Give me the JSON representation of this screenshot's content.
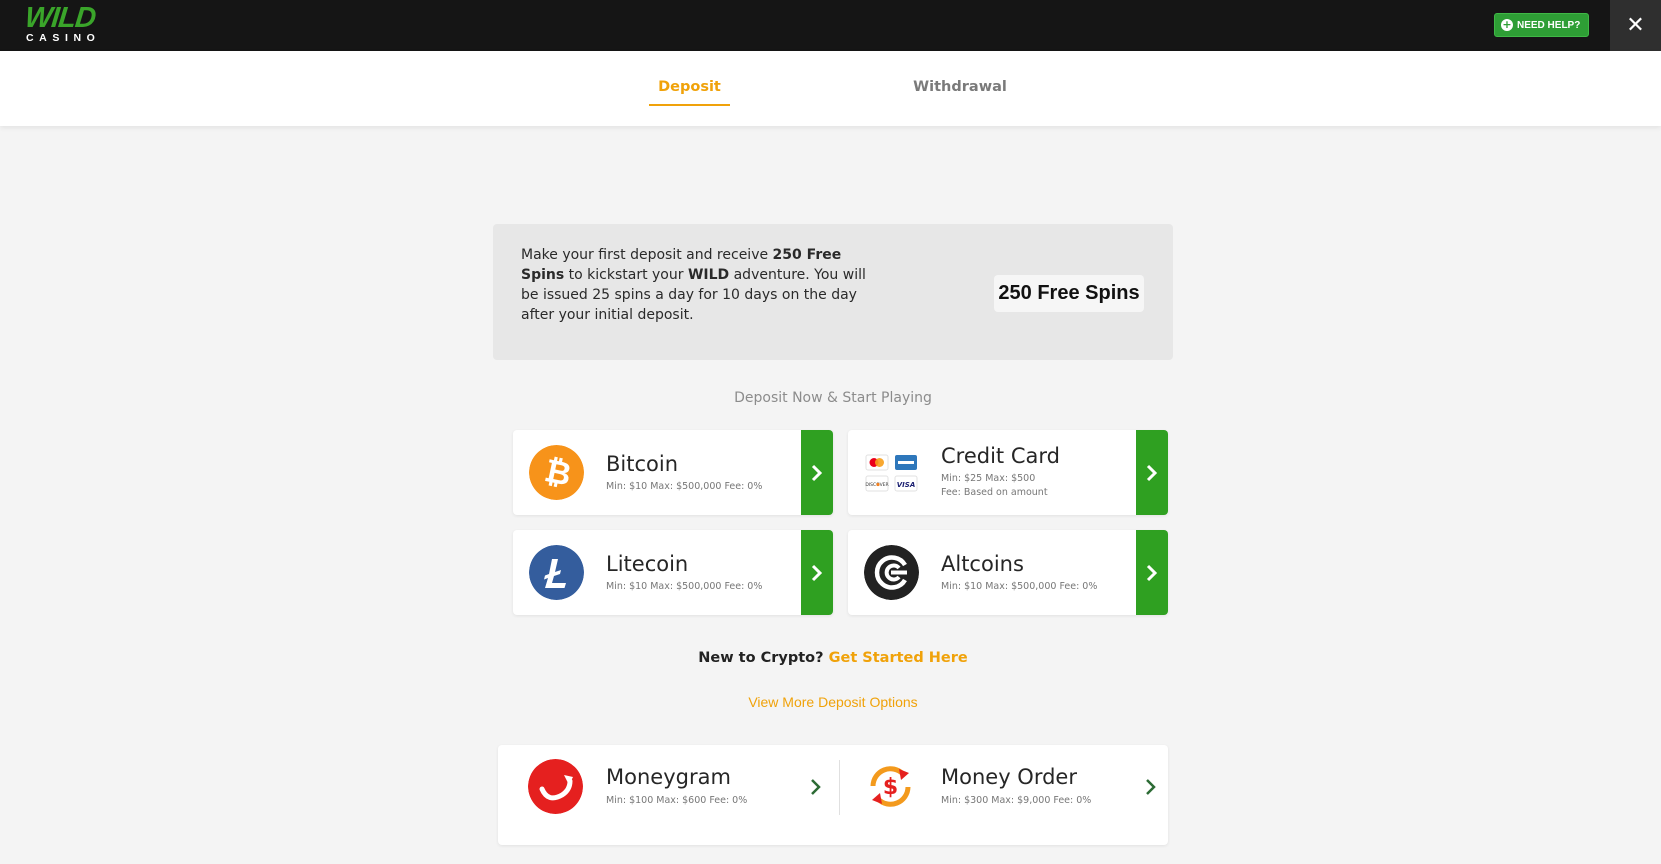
{
  "header": {
    "logo_main": "WILD",
    "logo_sub": "CASINO",
    "help_label": "NEED HELP?",
    "close_symbol": "✕"
  },
  "tabs": [
    {
      "label": "Deposit",
      "active": true
    },
    {
      "label": "Withdrawal",
      "active": false
    }
  ],
  "promo": {
    "text_1": "Make your first deposit and receive ",
    "text_bold_1": "250 Free Spins",
    "text_2": " to kickstart your ",
    "text_bold_2": "WILD",
    "text_3": " adventure. You will be issued 25 spins a day for 10 days on the day after your initial deposit.",
    "badge": "250 Free Spins"
  },
  "section_heading": "Deposit Now & Start Playing",
  "methods": [
    {
      "name": "Bitcoin",
      "meta": "Min: $10  Max: $500,000  Fee: 0%",
      "icon": "bitcoin-icon",
      "color": "#f7931a"
    },
    {
      "name": "Credit Card",
      "meta": "Min: $25  Max: $500",
      "meta2": "Fee: Based on amount",
      "icon": "credit-cards-icon"
    },
    {
      "name": "Litecoin",
      "meta": "Min: $10  Max: $500,000  Fee: 0%",
      "icon": "litecoin-icon",
      "color": "#345d9d"
    },
    {
      "name": "Altcoins",
      "meta": "Min: $10  Max: $500,000  Fee: 0%",
      "icon": "altcoins-icon",
      "color": "#222222"
    }
  ],
  "crypto": {
    "question": "New to Crypto?",
    "link": "Get Started Here"
  },
  "more_link": "View More Deposit Options",
  "more_methods": [
    {
      "name": "Moneygram",
      "meta": "Min: $100  Max: $600  Fee: 0%",
      "icon": "moneygram-icon",
      "color": "#e5201f"
    },
    {
      "name": "Money Order",
      "meta": "Min: $300  Max: $9,000  Fee: 0%",
      "icon": "money-order-icon",
      "color": "#f39a1d"
    }
  ],
  "colors": {
    "accent": "#f0a20a",
    "green": "#2fa021",
    "header_bg": "#151515"
  }
}
